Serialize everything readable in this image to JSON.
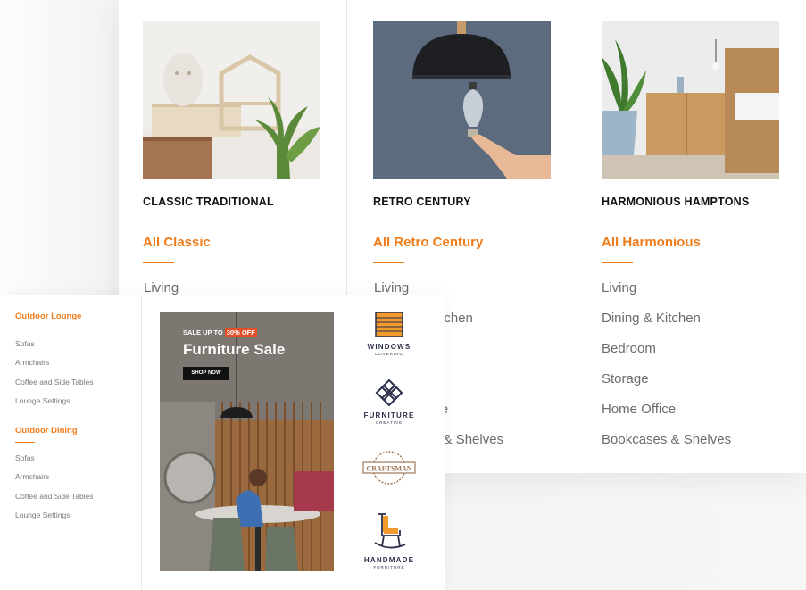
{
  "mega_menu": {
    "columns": [
      {
        "title": "CLASSIC TRADITIONAL",
        "all_link": "All Classic",
        "items": [
          "Living"
        ]
      },
      {
        "title": "RETRO CENTURY",
        "all_link": "All Retro Century",
        "items": [
          "Living",
          "Dining & Kitchen",
          "",
          "",
          "Home Office",
          "Bookcases & Shelves"
        ]
      },
      {
        "title": "HARMONIOUS HAMPTONS",
        "all_link": "All Harmonious",
        "items": [
          "Living",
          "Dining & Kitchen",
          "Bedroom",
          "Storage",
          "Home Office",
          "Bookcases & Shelves"
        ]
      }
    ]
  },
  "submenu": {
    "groups": [
      {
        "title": "Outdoor Lounge",
        "items": [
          "Sofas",
          "Armchairs",
          "Coffee and Side Tables",
          "Lounge Settings"
        ]
      },
      {
        "title": "Outdoor Dining",
        "items": [
          "Sofas",
          "Armchairs",
          "Coffee and Side Tables",
          "Lounge Settings"
        ]
      }
    ],
    "banner": {
      "top_text": "SALE UP TO",
      "discount": "30% OFF",
      "title": "Furniture Sale",
      "button": "SHOP NOW"
    },
    "brands": [
      {
        "name": "WINDOWS",
        "sub": "COVERING",
        "icon": "blinds-icon"
      },
      {
        "name": "FURNITURE",
        "sub": "CREATIVE",
        "icon": "knot-icon"
      },
      {
        "name": "CRAFTSMAN",
        "sub": "",
        "icon": "badge-icon"
      },
      {
        "name": "HANDMADE",
        "sub": "FURNITURE",
        "icon": "rocking-chair-icon"
      }
    ]
  },
  "colors": {
    "accent": "#f07c1b",
    "text": "#111111",
    "muted": "#6b6b6b"
  }
}
